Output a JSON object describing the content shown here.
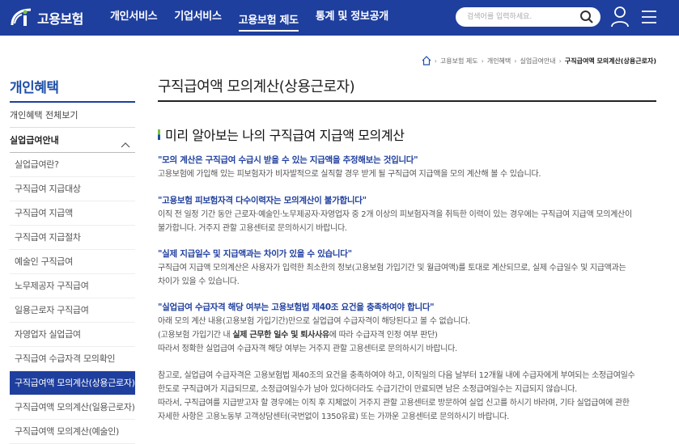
{
  "header": {
    "logo_text": "고용보험",
    "nav": [
      "개인서비스",
      "기업서비스",
      "고용보험 제도",
      "통계 및 정보공개"
    ],
    "active_nav": 2,
    "search_placeholder": "검색어를 입력하세요."
  },
  "breadcrumb": [
    "고용보험 제도",
    "개인혜택",
    "실업급여안내",
    "구직급여액 모의계산(상용근로자)"
  ],
  "sidebar": {
    "title": "개인혜택",
    "all_link": "개인혜택 전체보기",
    "group": "실업급여안내",
    "items": [
      "실업급여란?",
      "구직급여 지급대상",
      "구직급여 지급액",
      "구직급여 지급절차",
      "예술인 구직급여",
      "노무제공자 구직급여",
      "일용근로자 구직급여",
      "자영업자 실업급여",
      "구직급여 수급자격 모의확인",
      "구직급여액 모의계산(상용근로자)",
      "구직급여액 모의계산(일용근로자)",
      "구직급여액 모의계산(예술인)"
    ],
    "active_index": 9
  },
  "main": {
    "page_title": "구직급여액 모의계산(상용근로자)",
    "section_title": "미리 알아보는 나의 구직급여 지급액 모의계산",
    "q1": "\"모의 계산은 구직급여 수급시 받을 수 있는 지급액을 추정해보는 것입니다\"",
    "p1": "고용보험에 가입해 있는 피보험자가 비자발적으로 실직할 경우 받게 될 구직급여 지급액을 모의 계산해 볼 수 있습니다.",
    "q2": "\"고용보험 피보험자격 다수이력자는 모의계산이 불가합니다\"",
    "p2a": "이직 전 일정 기간 동안 근로자·예술인·노무제공자·자영업자 중 2개 이상의 피보험자격을 취득한 이력이 있는 경우에는 구직급여 지급액 모의계산이",
    "p2b": "불가합니다. 거주지 관할 고용센터로 문의하시기 바랍니다.",
    "q3": "\"실제 지급일수 및 지급액과는 차이가 있을 수 있습니다\"",
    "p3a": "구직급여 지급액 모의계산은 사용자가 입력한 최소한의 정보(고용보험 가입기간 및 월급여액)를 토대로 계산되므로, 실제 수급일수 및 지급액과는",
    "p3b": "차이가 있을 수 있습니다.",
    "q4": "\"실업급여 수급자격 해당 여부는 고용보험법 제40조 요건을 충족하여야 합니다\"",
    "p4a": "아래 모의 계산 내용(고용보험 가입기간)만으로 실업급여 수급자격이 해당된다고 볼 수 없습니다.",
    "p4b_pre": "(고용보험 가입기간 내 ",
    "p4b_bold": "실제 근무한 일수 및 퇴사사유",
    "p4b_post": "에 따라 수급자격 인정 여부 판단)",
    "p4c": "따라서 정확한 실업급여 수급자격 해당 여부는 거주지 관할 고용센터로 문의하시기 바랍니다.",
    "p5a": "참고로, 실업급여 수급자격은 고용보험법 제40조의 요건을 충족하여야 하고, 이직일의 다음 날부터 12개월 내에 수급자에게 부여되는 소정급여일수",
    "p5b": "한도로 구직급여가 지급되므로, 소정급여일수가 남아 있다하더라도 수급기간이 만료되면 남은 소정급여일수는 지급되지 않습니다.",
    "p5c": "따라서, 구직급여를 지급받고자 할 경우에는 이직 후 지체없이 거주지 관할 고용센터로 방문하여 실업 신고를 하시기 바라며, 기타 실업급여에 관한",
    "p5d": "자세한 사항은 고용노동부 고객상담센터(국번없이 1350유료) 또는 가까운 고용센터로 문의하시기 바랍니다."
  }
}
